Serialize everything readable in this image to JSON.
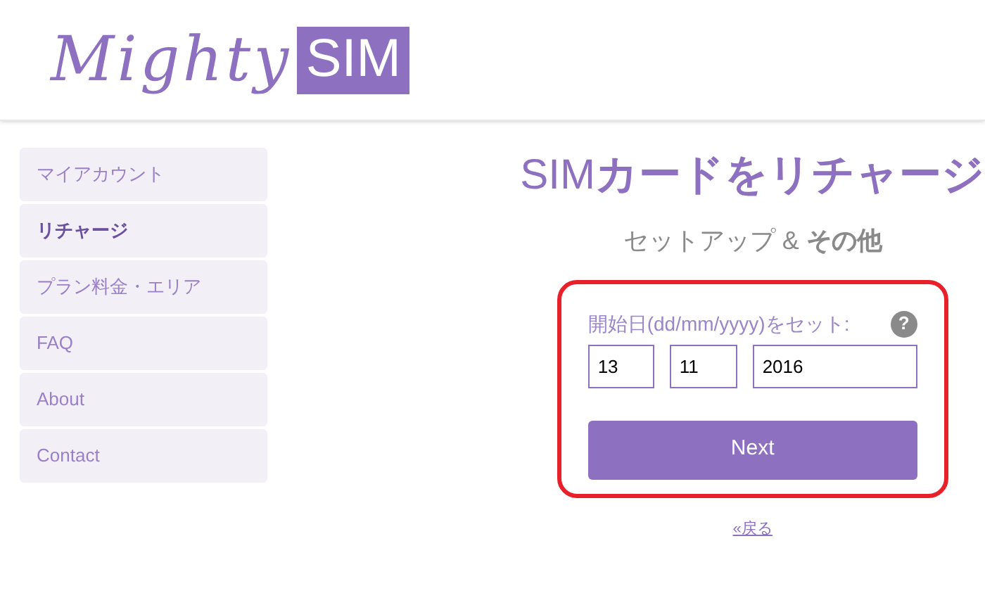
{
  "logo": {
    "word": "Mighty",
    "badge": "SIM"
  },
  "sidebar": {
    "items": [
      {
        "label": "マイアカウント",
        "selected": false
      },
      {
        "label": "リチャージ",
        "selected": true
      },
      {
        "label": "プラン料金・エリア",
        "selected": false
      },
      {
        "label": "FAQ",
        "selected": false
      },
      {
        "label": "About",
        "selected": false
      },
      {
        "label": "Contact",
        "selected": false
      }
    ]
  },
  "heading": "SIM**カードをリチャージ**",
  "subheading": "セットアップ & **その他**",
  "form": {
    "label": "開始日(dd/mm/yyyy)をセット:",
    "help": "?",
    "fields": [
      {
        "value": "13"
      },
      {
        "value": "11"
      },
      {
        "value": "2016"
      }
    ],
    "button": "Next"
  },
  "back_link": "«戻る"
}
